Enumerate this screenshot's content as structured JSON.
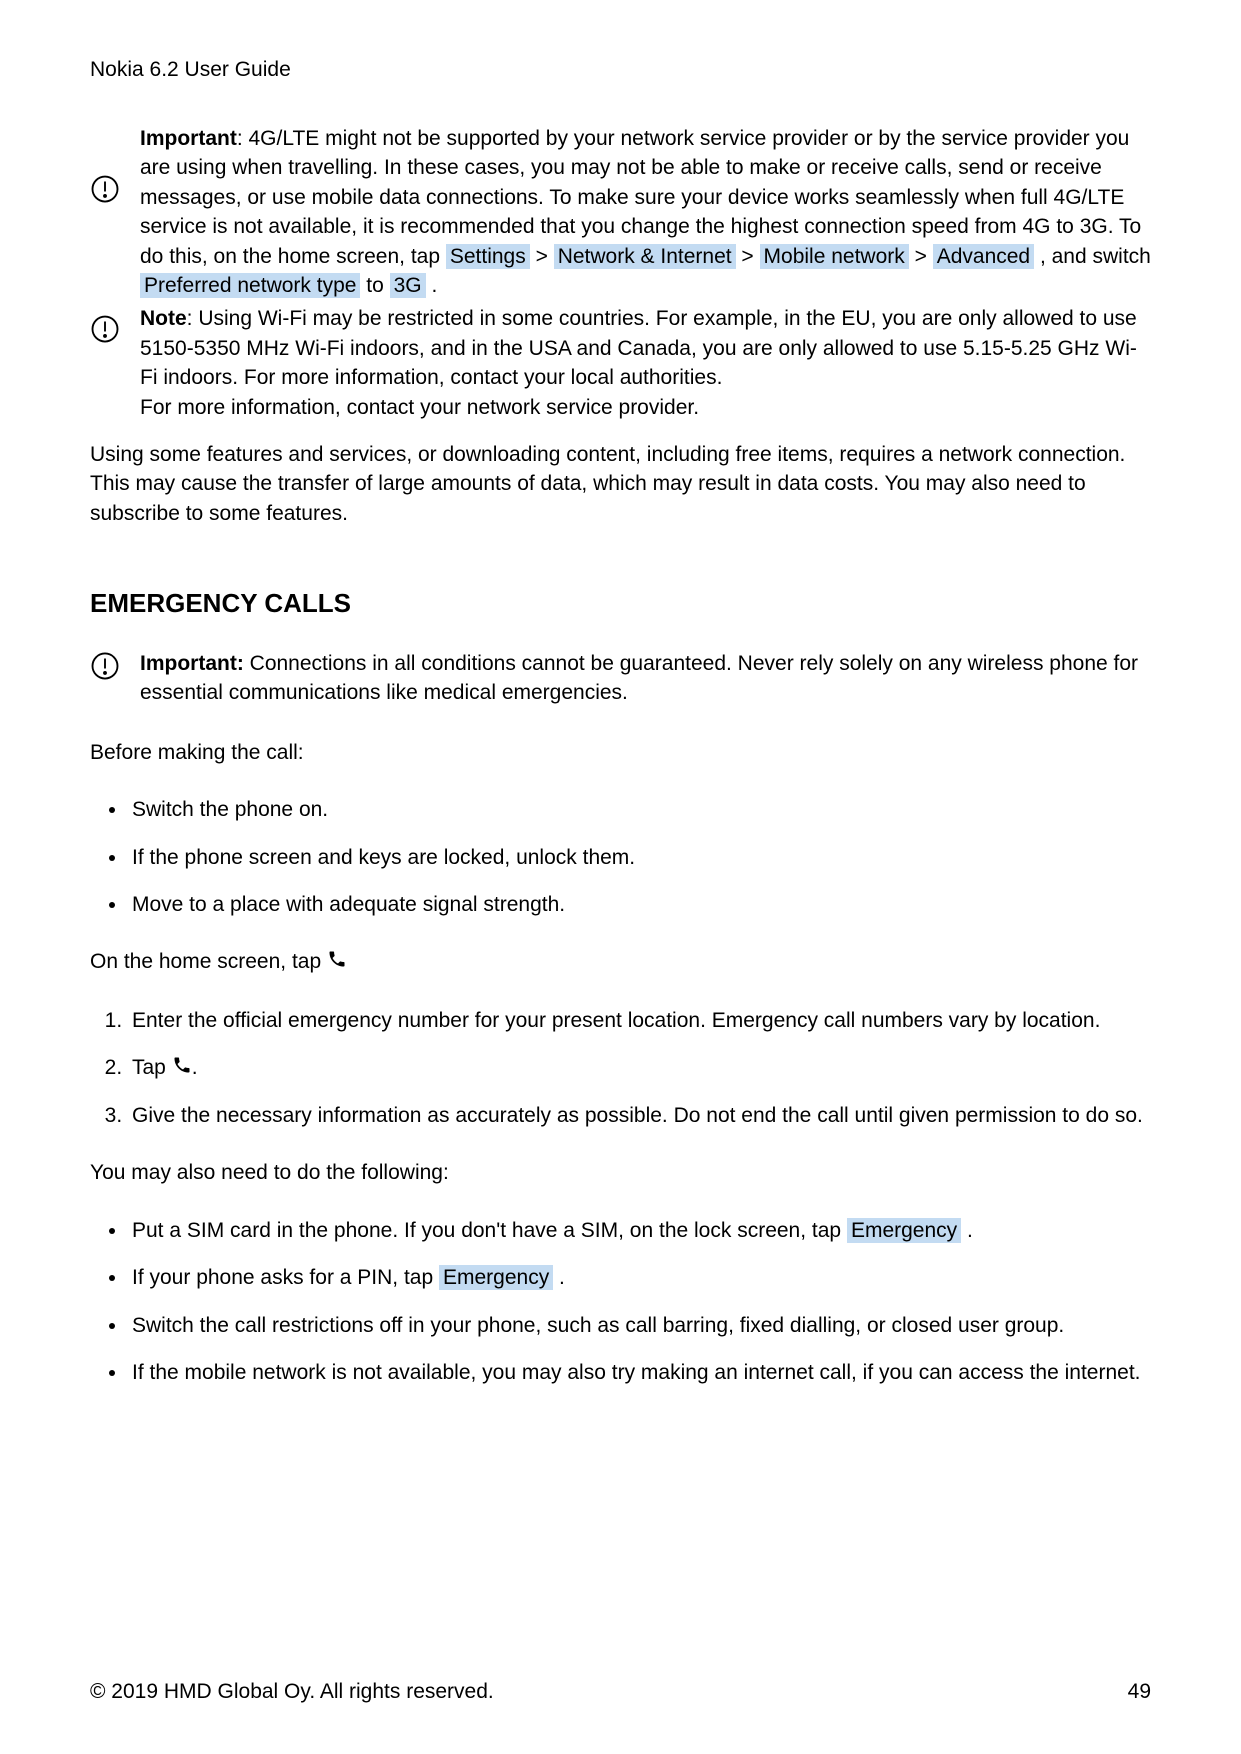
{
  "header": {
    "title": "Nokia 6.2 User Guide"
  },
  "notes": {
    "important_label": "Important",
    "important_text_1": ": 4G/LTE might not be supported by your network service provider or by the service provider you are using when travelling. In these cases, you may not be able to make or receive calls, send or receive messages, or use mobile data connections. To make sure your device works seamlessly when full 4G/LTE service is not available, it is recommended that you change the highest connection speed from 4G to 3G. To do this, on the home screen, tap ",
    "path": {
      "p1": "Settings",
      "p2": "Network & Internet",
      "p3": "Mobile network",
      "p4": "Advanced",
      "p5": "Preferred network type",
      "p6": "3G"
    },
    "important_text_2_a": " , and switch ",
    "important_text_2_b": " to ",
    "important_text_2_c": " .",
    "note_label": "Note",
    "note_text_1": ": Using Wi-Fi may be restricted in some countries. For example, in the EU, you are only allowed to use 5150-5350 MHz Wi-Fi indoors, and in the USA and Canada, you are only allowed to use 5.15-5.25 GHz Wi-Fi indoors. For more information, contact your local authorities.",
    "note_text_2": "For more information, contact your network service provider."
  },
  "para1": "Using some features and services, or downloading content, including free items, requires a network connection. This may cause the transfer of large amounts of data, which may result in data costs. You may also need to subscribe to some features.",
  "section": {
    "heading": "EMERGENCY CALLS",
    "important_label": "Important:",
    "important_text": " Connections in all conditions cannot be guaranteed. Never rely solely on any wireless phone for essential communications like medical emergencies.",
    "before": "Before making the call:",
    "bullets1": [
      "Switch the phone on.",
      "If the phone screen and keys are locked, unlock them.",
      "Move to a place with adequate signal strength."
    ],
    "home_tap": "On the home screen, tap ",
    "steps": {
      "s1": "Enter the official emergency number for your present location. Emergency call numbers vary by location.",
      "s2a": "Tap ",
      "s2b": ".",
      "s3": "Give the necessary information as accurately as possible. Do not end the call until given permission to do so."
    },
    "also": "You may also need to do the following:",
    "bullets2": {
      "b1a": "Put a SIM card in the phone. If you don't have a SIM, on the lock screen, tap ",
      "b1_hl": "Emergency",
      "b1b": " .",
      "b2a": "If your phone asks for a PIN, tap ",
      "b2_hl": "Emergency",
      "b2b": " .",
      "b3": "Switch the call restrictions off in your phone, such as call barring, fixed dialling, or closed user group.",
      "b4": "If the mobile network is not available, you may also try making an internet call, if you can access the internet."
    }
  },
  "footer": {
    "copyright": "© 2019 HMD Global Oy. All rights reserved.",
    "page": "49"
  }
}
